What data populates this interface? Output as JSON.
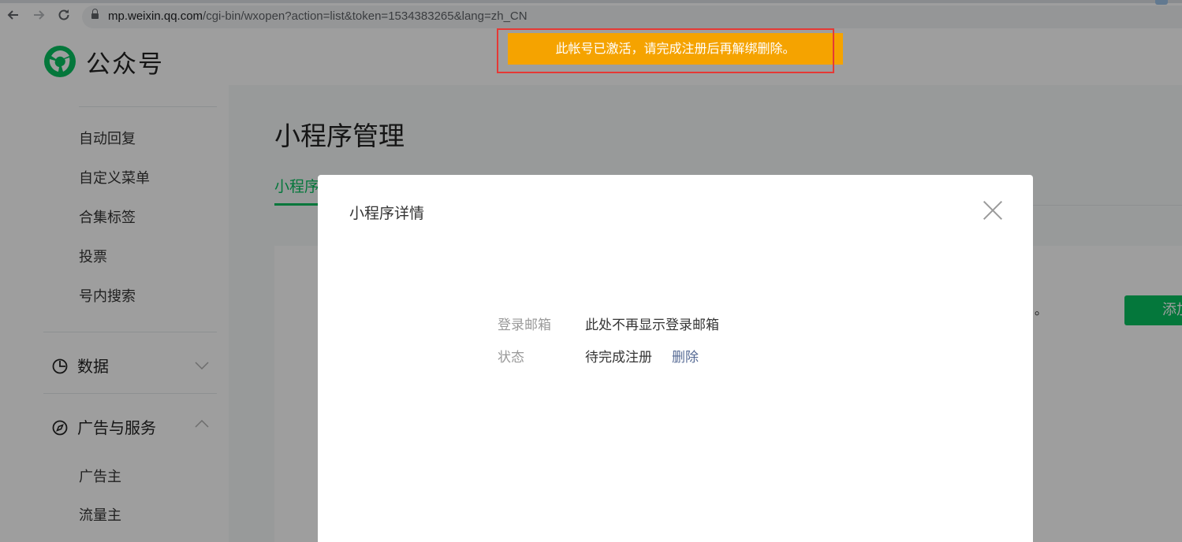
{
  "browser": {
    "url_host": "mp.weixin.qq.com",
    "url_path": "/cgi-bin/wxopen?action=list&token=1534383265&lang=zh_CN",
    "icons": [
      "back-arrow-icon",
      "forward-arrow-icon",
      "reload-icon",
      "lock-icon"
    ]
  },
  "header": {
    "logo_text": "公众号"
  },
  "sidebar": {
    "items_top": [
      "自动回复",
      "自定义菜单",
      "合集标签",
      "投票",
      "号内搜索"
    ],
    "group_data": {
      "label": "数据",
      "icon": "pie-chart-icon",
      "expanded": false
    },
    "group_ads": {
      "label": "广告与服务",
      "icon": "compass-icon",
      "expanded": true
    },
    "items_ads": [
      "广告主",
      "流量主"
    ]
  },
  "main": {
    "title": "小程序管理",
    "active_tab": "小程序",
    "add_button": "添加",
    "trailing_text": "。"
  },
  "dialog": {
    "title": "小程序详情",
    "rows": [
      {
        "label": "登录邮箱",
        "value": "此处不再显示登录邮箱"
      },
      {
        "label": "状态",
        "value": "待完成注册",
        "action": "删除"
      }
    ]
  },
  "toast": {
    "message": "此帐号已激活，请完成注册后再解绑删除。"
  },
  "colors": {
    "brand_green": "#07c160",
    "toast_orange": "#f5a300",
    "link_blue": "#576b95",
    "highlight_red": "#e53935"
  }
}
